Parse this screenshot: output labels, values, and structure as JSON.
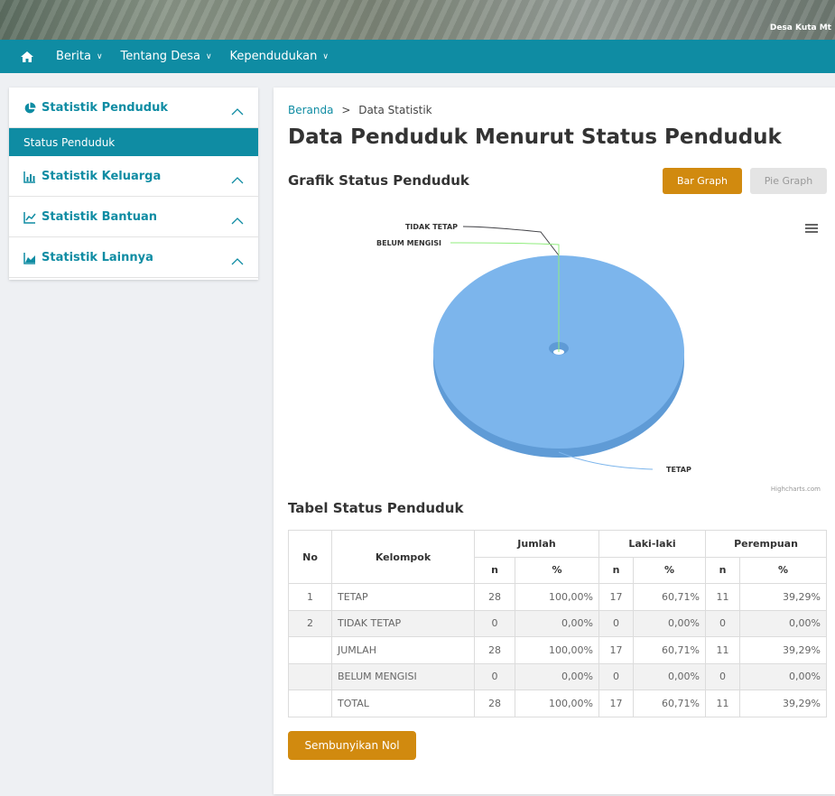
{
  "header": {
    "site_name": "Desa Kuta Mt"
  },
  "nav": {
    "items": [
      {
        "label": "Berita"
      },
      {
        "label": "Tentang Desa"
      },
      {
        "label": "Kependudukan"
      }
    ]
  },
  "sidebar": {
    "sections": [
      {
        "label": "Statistik Penduduk",
        "icon": "pie-chart-icon"
      },
      {
        "label": "Statistik Keluarga",
        "icon": "bar-chart-icon"
      },
      {
        "label": "Statistik Bantuan",
        "icon": "line-chart-icon"
      },
      {
        "label": "Statistik Lainnya",
        "icon": "area-chart-icon"
      }
    ],
    "active_item": "Status Penduduk"
  },
  "breadcrumb": {
    "home": "Beranda",
    "sep": ">",
    "current": "Data Statistik"
  },
  "page_title": "Data Penduduk Menurut Status Penduduk",
  "chart_section": {
    "heading": "Grafik Status Penduduk",
    "bar_button": "Bar Graph",
    "pie_button": "Pie Graph",
    "credits": "Highcharts.com"
  },
  "chart_data": {
    "type": "pie",
    "title": "",
    "categories": [
      "TETAP",
      "TIDAK TETAP",
      "BELUM MENGISI"
    ],
    "values": [
      28,
      0,
      0
    ],
    "colors": [
      "#7cb5ec",
      "#434348",
      "#90ed7d"
    ]
  },
  "table_section": {
    "heading": "Tabel Status Penduduk",
    "headers": {
      "no": "No",
      "kelompok": "Kelompok",
      "jumlah": "Jumlah",
      "laki": "Laki-laki",
      "perempuan": "Perempuan",
      "n": "n",
      "pct": "%"
    },
    "rows": [
      {
        "no": "1",
        "kelompok": "TETAP",
        "jn": "28",
        "jp": "100,00%",
        "ln": "17",
        "lp": "60,71%",
        "pn": "11",
        "pp": "39,29%"
      },
      {
        "no": "2",
        "kelompok": "TIDAK TETAP",
        "jn": "0",
        "jp": "0,00%",
        "ln": "0",
        "lp": "0,00%",
        "pn": "0",
        "pp": "0,00%"
      },
      {
        "no": "",
        "kelompok": "JUMLAH",
        "jn": "28",
        "jp": "100,00%",
        "ln": "17",
        "lp": "60,71%",
        "pn": "11",
        "pp": "39,29%"
      },
      {
        "no": "",
        "kelompok": "BELUM MENGISI",
        "jn": "0",
        "jp": "0,00%",
        "ln": "0",
        "lp": "0,00%",
        "pn": "0",
        "pp": "0,00%"
      },
      {
        "no": "",
        "kelompok": "TOTAL",
        "jn": "28",
        "jp": "100,00%",
        "ln": "17",
        "lp": "60,71%",
        "pn": "11",
        "pp": "39,29%"
      }
    ]
  },
  "hide_zero_button": "Sembunyikan Nol",
  "colors": {
    "accent": "#0f8ca3",
    "button": "#d18a0f"
  }
}
